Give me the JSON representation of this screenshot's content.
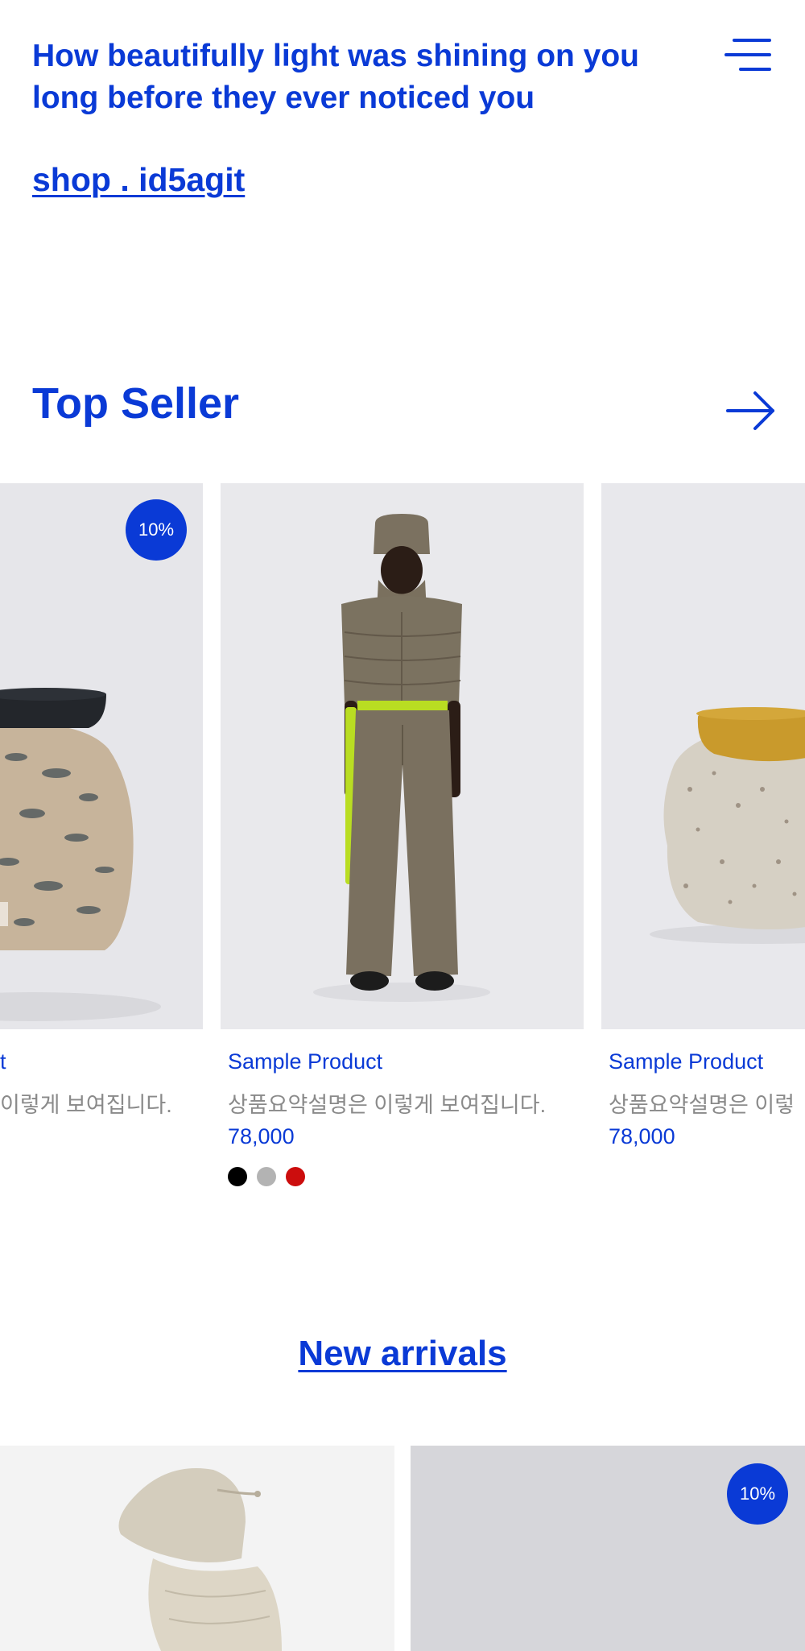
{
  "header": {
    "tagline": "How beautifully light was shining on you long before they ever noticed you",
    "shop_link": "shop . id5agit",
    "menu_icon": "hamburger-menu-icon"
  },
  "top_seller": {
    "title": "Top Seller",
    "arrow_icon": "arrow-right-icon",
    "products": [
      {
        "name": "Sample Product",
        "name_visible": "t",
        "description": "상품요약설명은 이렇게 보여집니다.",
        "description_visible": "이렇게 보여집니다.",
        "badge": "10%",
        "image": "stool-sculpture-black-top"
      },
      {
        "name": "Sample Product",
        "description": "상품요약설명은 이렇게 보여집니다.",
        "price": "78,000",
        "swatches": [
          "#000000",
          "#b3b3b3",
          "#cc0d0d"
        ],
        "image": "model-olive-puffer-vest"
      },
      {
        "name": "Sample Product",
        "description": "상품요약설명은 이렇",
        "price": "78,000",
        "image": "stool-sculpture-mustard-top"
      }
    ]
  },
  "new_arrivals": {
    "title": "New arrivals",
    "products": [
      {
        "image": "model-beige-hood"
      },
      {
        "badge": "10%",
        "image": "grey-placeholder"
      }
    ]
  },
  "colors": {
    "accent": "#0a3ad6",
    "muted_text": "#8a8a8a",
    "image_bg": "#e9e9ec"
  }
}
